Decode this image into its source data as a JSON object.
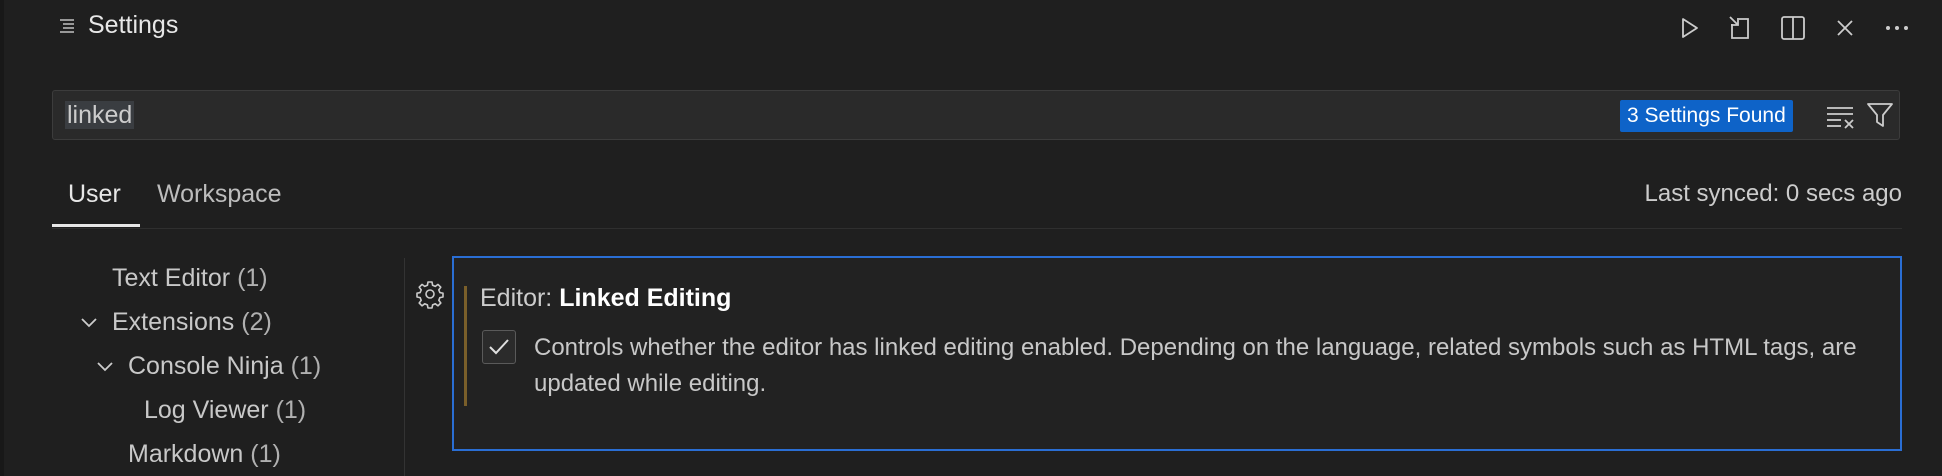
{
  "window": {
    "title": "Settings"
  },
  "toolbar": {
    "icons": [
      "run-icon",
      "open-settings-json-icon",
      "split-editor-icon",
      "close-icon",
      "more-actions-icon"
    ]
  },
  "search": {
    "value": "linked",
    "result_badge": "3 Settings Found",
    "icons": [
      "clear-filter-icon",
      "filter-icon"
    ]
  },
  "tabs": [
    {
      "label": "User",
      "active": true
    },
    {
      "label": "Workspace",
      "active": false
    }
  ],
  "sync": {
    "status": "Last synced: 0 secs ago"
  },
  "toc": {
    "items": [
      {
        "label": "Text Editor",
        "count": "(1)",
        "expanded": null
      },
      {
        "label": "Extensions",
        "count": "(2)",
        "expanded": true
      },
      {
        "label": "Console Ninja",
        "count": "(1)",
        "expanded": true
      },
      {
        "label": "Log Viewer",
        "count": "(1)",
        "expanded": null
      },
      {
        "label": "Markdown",
        "count": "(1)",
        "expanded": null
      }
    ]
  },
  "setting": {
    "category": "Editor: ",
    "name": "Linked Editing",
    "checked": true,
    "description": "Controls whether the editor has linked editing enabled. Depending on the language, related symbols such as HTML tags, are updated while editing."
  },
  "colors": {
    "background": "#1f1f1f",
    "accent": "#0e63c8",
    "focus_border": "#2a6ed4",
    "modified_indicator": "#7a5f2a"
  }
}
